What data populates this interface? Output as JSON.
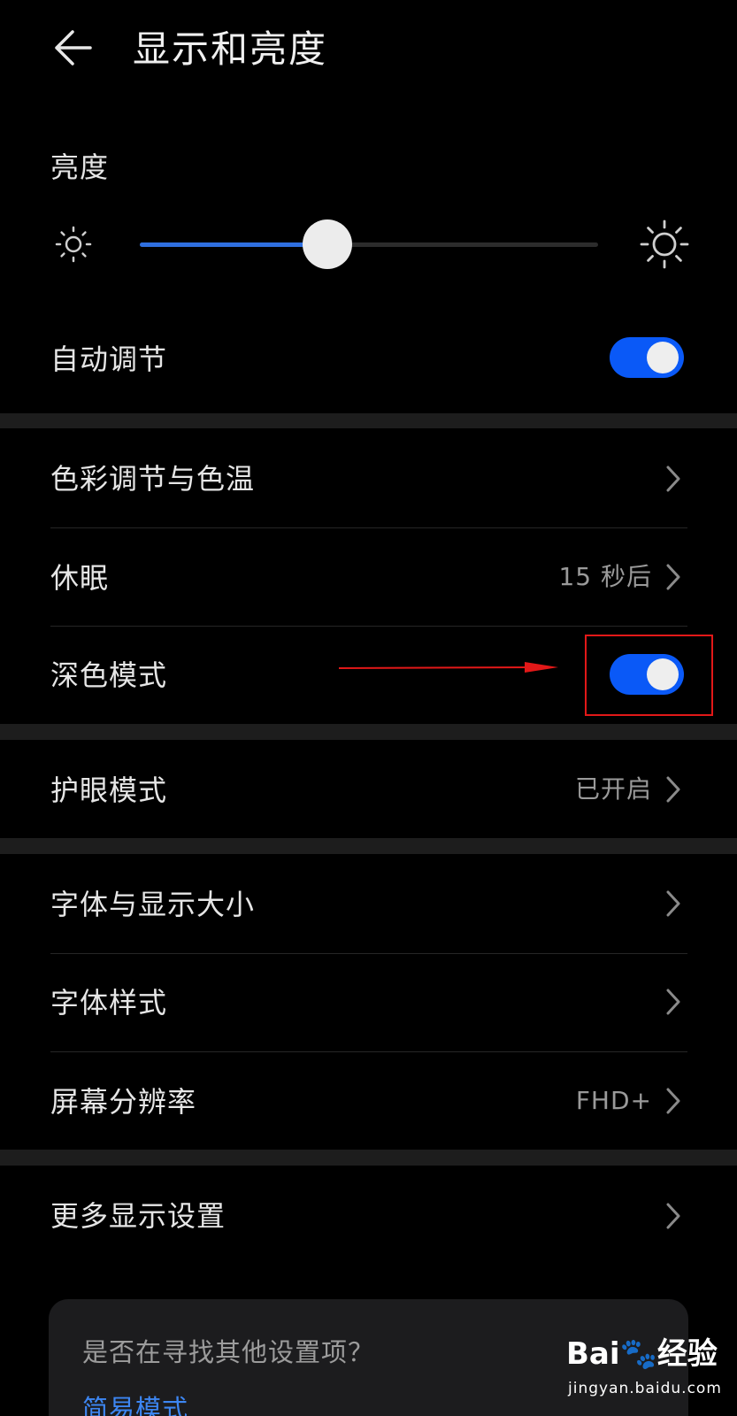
{
  "header": {
    "title": "显示和亮度",
    "back_icon": "arrow-left-icon"
  },
  "brightness": {
    "section_title": "亮度",
    "level_percent": 41,
    "low_icon": "sun-small-icon",
    "high_icon": "sun-large-icon"
  },
  "auto_adjust": {
    "label": "自动调节",
    "enabled": true
  },
  "items": {
    "color_temp": {
      "label": "色彩调节与色温"
    },
    "sleep": {
      "label": "休眠",
      "value": "15 秒后"
    },
    "dark_mode": {
      "label": "深色模式",
      "enabled": true
    },
    "eye_comfort": {
      "label": "护眼模式",
      "value": "已开启"
    },
    "font_size": {
      "label": "字体与显示大小"
    },
    "font_style": {
      "label": "字体样式"
    },
    "resolution": {
      "label": "屏幕分辨率",
      "value": "FHD+"
    },
    "more_display": {
      "label": "更多显示设置"
    }
  },
  "suggestion": {
    "question": "是否在寻找其他设置项？",
    "link": "简易模式"
  },
  "watermark": {
    "logo": "Bai🐾经验",
    "jingyan": "",
    "url": "jingyan.baidu.com"
  },
  "colors": {
    "accent": "#0a59f7",
    "slider_fill": "#2f6fe0",
    "highlight": "#e21818",
    "link": "#3d86f2",
    "background": "#000000"
  }
}
